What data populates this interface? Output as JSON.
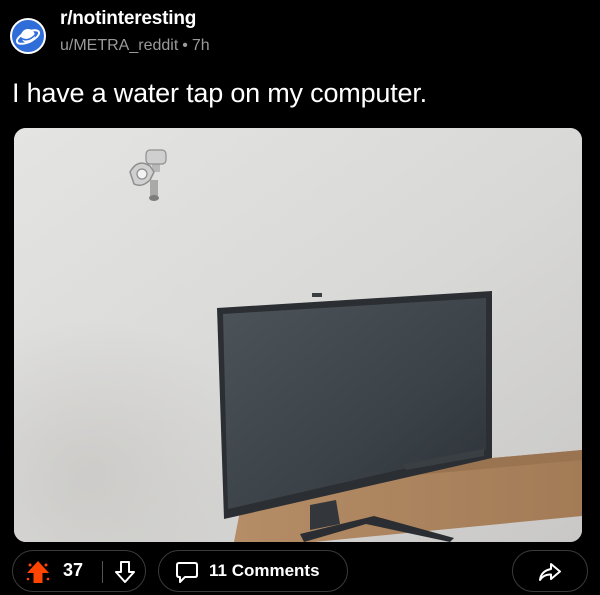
{
  "post": {
    "subreddit": "r/notinteresting",
    "author": "u/METRA_reddit",
    "separator": "•",
    "age": "7h",
    "title": "I have a water tap on my computer.",
    "image_icon": "post-photo-monitor-with-tap"
  },
  "actions": {
    "score": "37",
    "upvote_icon": "upvote-arrow-icon",
    "downvote_icon": "downvote-arrow-icon",
    "comments_label": "11 Comments",
    "comment_icon": "comment-bubble-icon",
    "share_icon": "share-arrow-icon"
  },
  "colors": {
    "background": "#000000",
    "text": "#ffffff",
    "muted": "#9a9a9a",
    "upvote_accent": "#ff4500",
    "avatar": "#2f6dd8",
    "pill_border": "#3a3a3a"
  }
}
